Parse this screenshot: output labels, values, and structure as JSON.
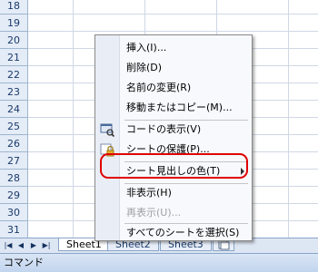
{
  "row_numbers": [
    "18",
    "19",
    "20",
    "21",
    "22",
    "23",
    "24",
    "25",
    "26",
    "27",
    "28",
    "29",
    "30",
    "31"
  ],
  "sheet_tabs": [
    "Sheet1",
    "Sheet2",
    "Sheet3"
  ],
  "status": {
    "mode": "コマンド"
  },
  "context_menu": {
    "items": [
      {
        "label": "挿入(I)...",
        "icon": ""
      },
      {
        "label": "削除(D)",
        "icon": ""
      },
      {
        "label": "名前の変更(R)",
        "icon": ""
      },
      {
        "label": "移動またはコピー(M)...",
        "icon": ""
      },
      {
        "label": "コードの表示(V)",
        "icon": "code-view-icon"
      },
      {
        "label": "シートの保護(P)...",
        "icon": "lock-icon"
      },
      {
        "label": "シート見出しの色(T)",
        "icon": "",
        "has_submenu": true,
        "highlighted": true
      },
      {
        "label": "非表示(H)",
        "icon": ""
      },
      {
        "label": "再表示(U)...",
        "icon": "",
        "disabled": true
      },
      {
        "label": "すべてのシートを選択(S)",
        "icon": ""
      }
    ]
  },
  "colors": {
    "highlight_outline": "#e00000",
    "row_header_bg": "#e4ecf7"
  }
}
